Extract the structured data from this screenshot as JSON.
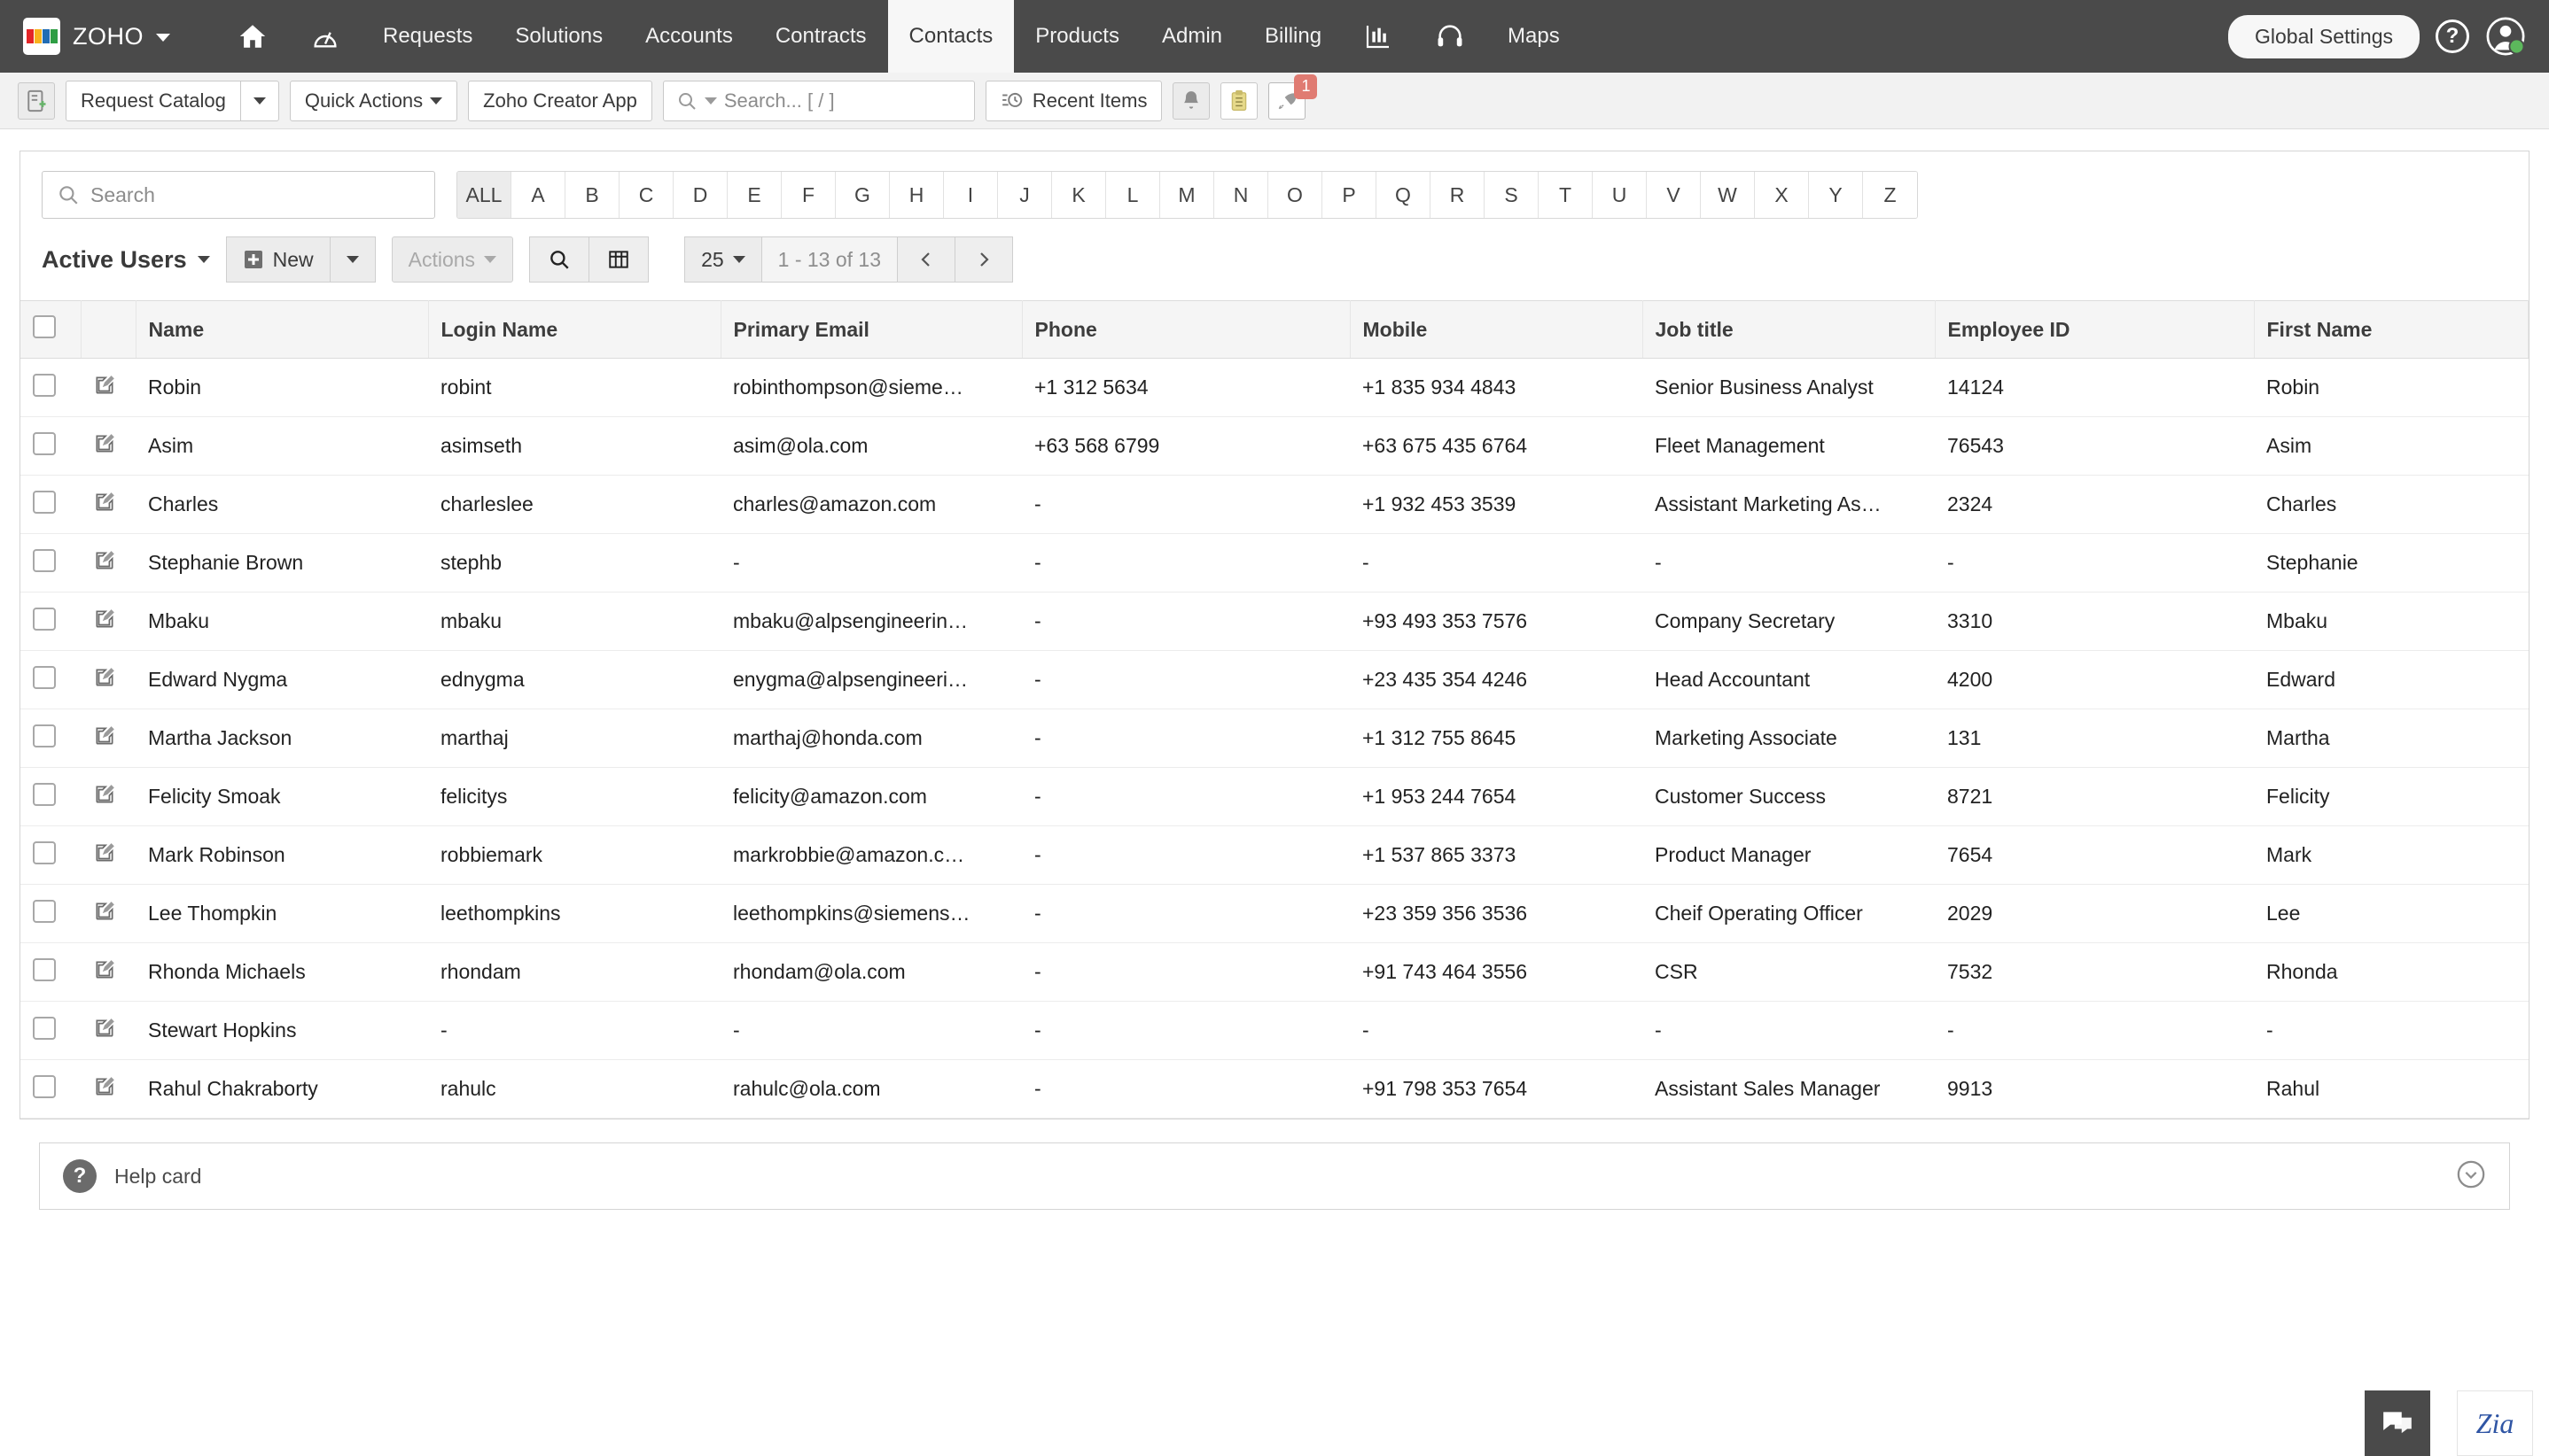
{
  "topnav": {
    "brand": "ZOHO",
    "brand_caret_icon": "chevron-down-icon",
    "items": [
      {
        "label": "",
        "icon": "home-icon",
        "active": false
      },
      {
        "label": "",
        "icon": "dashboard-gauge-icon",
        "active": false
      },
      {
        "label": "Requests",
        "icon": "",
        "active": false
      },
      {
        "label": "Solutions",
        "icon": "",
        "active": false
      },
      {
        "label": "Accounts",
        "icon": "",
        "active": false
      },
      {
        "label": "Contracts",
        "icon": "",
        "active": false
      },
      {
        "label": "Contacts",
        "icon": "",
        "active": true
      },
      {
        "label": "Products",
        "icon": "",
        "active": false
      },
      {
        "label": "Admin",
        "icon": "",
        "active": false
      },
      {
        "label": "Billing",
        "icon": "",
        "active": false
      },
      {
        "label": "",
        "icon": "bar-chart-icon",
        "active": false
      },
      {
        "label": "",
        "icon": "headset-icon",
        "active": false
      },
      {
        "label": "Maps",
        "icon": "",
        "active": false
      }
    ],
    "global_settings": "Global Settings",
    "help_glyph": "?",
    "help_icon": "help-icon",
    "avatar_icon": "user-avatar-icon",
    "bg_color": "#4a4a4a"
  },
  "subbar": {
    "catalog_icon": "request-catalog-icon",
    "request_catalog": "Request Catalog",
    "quick_actions": "Quick Actions",
    "creator_app": "Zoho Creator App",
    "search_placeholder": "Search... [ / ]",
    "search_icon": "search-icon",
    "recent_items": "Recent Items",
    "recent_icon": "recent-items-icon",
    "bell_icon": "notification-bell-icon",
    "clipboard_icon": "clipboard-icon",
    "rocket_icon": "rocket-icon",
    "rocket_badge": "1",
    "badge_color": "#e07b72"
  },
  "filters": {
    "search_placeholder": "Search",
    "search_icon": "search-icon",
    "alphabet": [
      "ALL",
      "A",
      "B",
      "C",
      "D",
      "E",
      "F",
      "G",
      "H",
      "I",
      "J",
      "K",
      "L",
      "M",
      "N",
      "O",
      "P",
      "Q",
      "R",
      "S",
      "T",
      "U",
      "V",
      "W",
      "X",
      "Y",
      "Z"
    ],
    "selected_letter": "ALL"
  },
  "listbar": {
    "view_name": "Active Users",
    "view_caret_icon": "chevron-down-icon",
    "new_label": "New",
    "new_icon": "plus-square-icon",
    "new_caret_icon": "chevron-down-icon",
    "actions_label": "Actions",
    "actions_caret_icon": "chevron-down-icon",
    "actions_disabled": true,
    "search_icon": "search-icon",
    "grid_icon": "grid-columns-icon",
    "page_size": "25",
    "page_size_caret_icon": "chevron-down-icon",
    "range_label": "1 - 13 of 13",
    "prev_icon": "chevron-left-icon",
    "next_icon": "chevron-right-icon"
  },
  "table": {
    "select_all_icon": "checkbox-icon",
    "columns": [
      "",
      "",
      "Name",
      "Login Name",
      "Primary Email",
      "Phone",
      "Mobile",
      "Job title",
      "Employee ID",
      "First Name"
    ],
    "row_edit_icon": "edit-pencil-icon",
    "row_checkbox_icon": "checkbox-icon",
    "rows": [
      {
        "name": "Robin",
        "login": "robint",
        "email": "robinthompson@sieme…",
        "phone": "+1 312 5634",
        "mobile": "+1 835 934 4843",
        "job": "Senior Business Analyst",
        "emp": "14124",
        "first": "Robin"
      },
      {
        "name": "Asim",
        "login": "asimseth",
        "email": "asim@ola.com",
        "phone": "+63 568 6799",
        "mobile": "+63 675 435 6764",
        "job": "Fleet Management",
        "emp": "76543",
        "first": "Asim"
      },
      {
        "name": "Charles",
        "login": "charleslee",
        "email": "charles@amazon.com",
        "phone": "-",
        "mobile": "+1 932 453 3539",
        "job": "Assistant Marketing As…",
        "emp": "2324",
        "first": "Charles"
      },
      {
        "name": "Stephanie Brown",
        "login": "stephb",
        "email": "-",
        "phone": "-",
        "mobile": "-",
        "job": "-",
        "emp": "-",
        "first": "Stephanie"
      },
      {
        "name": "Mbaku",
        "login": "mbaku",
        "email": "mbaku@alpsengineerin…",
        "phone": "-",
        "mobile": "+93 493 353 7576",
        "job": "Company Secretary",
        "emp": "3310",
        "first": "Mbaku"
      },
      {
        "name": "Edward Nygma",
        "login": "ednygma",
        "email": "enygma@alpsengineeri…",
        "phone": "-",
        "mobile": "+23 435 354 4246",
        "job": "Head Accountant",
        "emp": "4200",
        "first": "Edward"
      },
      {
        "name": "Martha Jackson",
        "login": "marthaj",
        "email": "marthaj@honda.com",
        "phone": "-",
        "mobile": "+1 312 755 8645",
        "job": "Marketing Associate",
        "emp": "131",
        "first": "Martha"
      },
      {
        "name": "Felicity Smoak",
        "login": "felicitys",
        "email": "felicity@amazon.com",
        "phone": "-",
        "mobile": "+1 953 244 7654",
        "job": "Customer Success",
        "emp": "8721",
        "first": "Felicity"
      },
      {
        "name": "Mark Robinson",
        "login": "robbiemark",
        "email": "markrobbie@amazon.c…",
        "phone": "-",
        "mobile": "+1 537 865 3373",
        "job": "Product Manager",
        "emp": "7654",
        "first": "Mark"
      },
      {
        "name": "Lee Thompkin",
        "login": "leethompkins",
        "email": "leethompkins@siemens…",
        "phone": "-",
        "mobile": "+23 359 356 3536",
        "job": "Cheif Operating Officer",
        "emp": "2029",
        "first": "Lee"
      },
      {
        "name": "Rhonda Michaels",
        "login": "rhondam",
        "email": "rhondam@ola.com",
        "phone": "-",
        "mobile": "+91 743 464 3556",
        "job": "CSR",
        "emp": "7532",
        "first": "Rhonda"
      },
      {
        "name": "Stewart Hopkins",
        "login": "-",
        "email": "-",
        "phone": "-",
        "mobile": "-",
        "job": "-",
        "emp": "-",
        "first": "-"
      },
      {
        "name": "Rahul Chakraborty",
        "login": "rahulc",
        "email": "rahulc@ola.com",
        "phone": "-",
        "mobile": "+91 798 353 7654",
        "job": "Assistant Sales Manager",
        "emp": "9913",
        "first": "Rahul"
      }
    ]
  },
  "helpcard": {
    "icon": "help-circle-icon",
    "label": "Help card",
    "expand_icon": "chevron-down-circle-icon"
  },
  "floating": {
    "chat_icon": "chat-bubbles-icon",
    "zia_label": "Zia",
    "zia_color": "#2f55a4"
  }
}
